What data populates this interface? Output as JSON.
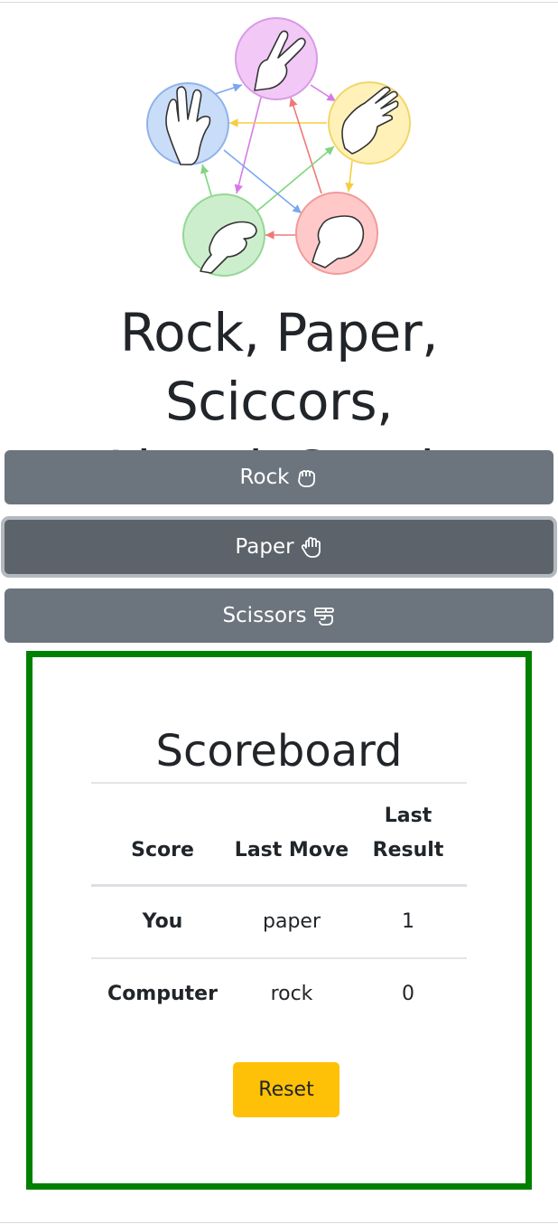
{
  "title_line1": "Rock, Paper, Sciccors,",
  "title_line2": "Lizard, Spock",
  "buttons": {
    "rock": {
      "label": "Rock",
      "icon": "hand-rock-icon"
    },
    "paper": {
      "label": "Paper",
      "icon": "hand-paper-icon"
    },
    "scissors": {
      "label": "Scissors",
      "icon": "hand-scissors-icon"
    }
  },
  "scoreboard": {
    "title": "Scoreboard",
    "headers": {
      "score": "Score",
      "last_move": "Last Move",
      "last_result": "Last Result"
    },
    "rows": [
      {
        "player": "You",
        "last_move": "paper",
        "last_result": "1"
      },
      {
        "player": "Computer",
        "last_move": "rock",
        "last_result": "0"
      }
    ],
    "reset_label": "Reset",
    "border_color": "#008000"
  },
  "colors": {
    "button_bg": "#6c757d",
    "button_active_bg": "#5c636a",
    "reset_bg": "#ffc107"
  }
}
